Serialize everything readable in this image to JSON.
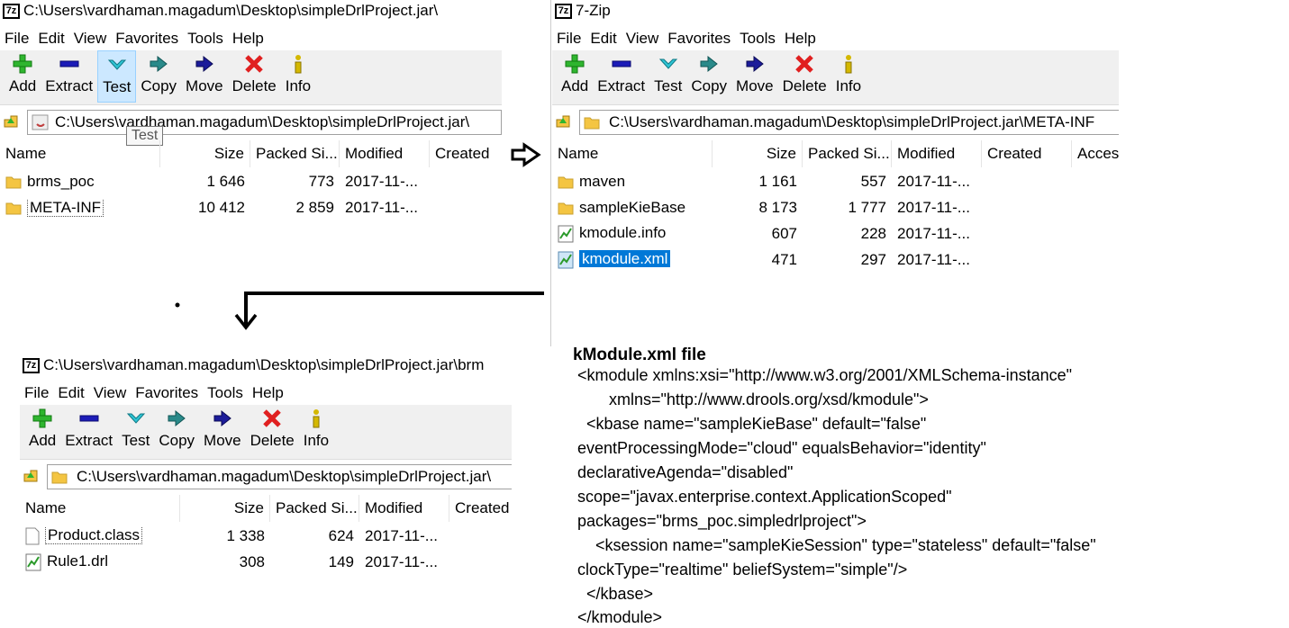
{
  "windows": {
    "top_left": {
      "title": "C:\\Users\\vardhaman.magadum\\Desktop\\simpleDrlProject.jar\\",
      "path": "C:\\Users\\vardhaman.magadum\\Desktop\\simpleDrlProject.jar\\",
      "tooltip": "Test",
      "columns": [
        "Name",
        "Size",
        "Packed Si...",
        "Modified",
        "Created"
      ],
      "rows": [
        {
          "name": "brms_poc",
          "size": "1 646",
          "packed": "773",
          "modified": "2017-11-..."
        },
        {
          "name": "META-INF",
          "size": "10 412",
          "packed": "2 859",
          "modified": "2017-11-..."
        }
      ]
    },
    "top_right": {
      "title": "7-Zip",
      "path": "C:\\Users\\vardhaman.magadum\\Desktop\\simpleDrlProject.jar\\META-INF",
      "columns": [
        "Name",
        "Size",
        "Packed Si...",
        "Modified",
        "Created",
        "Acces"
      ],
      "rows": [
        {
          "name": "maven",
          "size": "1 161",
          "packed": "557",
          "modified": "2017-11-..."
        },
        {
          "name": "sampleKieBase",
          "size": "8 173",
          "packed": "1 777",
          "modified": "2017-11-..."
        },
        {
          "name": "kmodule.info",
          "size": "607",
          "packed": "228",
          "modified": "2017-11-..."
        },
        {
          "name": "kmodule.xml",
          "size": "471",
          "packed": "297",
          "modified": "2017-11-..."
        }
      ]
    },
    "bottom_left": {
      "title": "C:\\Users\\vardhaman.magadum\\Desktop\\simpleDrlProject.jar\\brm",
      "path": "C:\\Users\\vardhaman.magadum\\Desktop\\simpleDrlProject.jar\\",
      "columns": [
        "Name",
        "Size",
        "Packed Si...",
        "Modified",
        "Created"
      ],
      "rows": [
        {
          "name": "Product.class",
          "size": "1 338",
          "packed": "624",
          "modified": "2017-11-..."
        },
        {
          "name": "Rule1.drl",
          "size": "308",
          "packed": "149",
          "modified": "2017-11-..."
        }
      ]
    }
  },
  "menu": [
    "File",
    "Edit",
    "View",
    "Favorites",
    "Tools",
    "Help"
  ],
  "toolbar": [
    "Add",
    "Extract",
    "Test",
    "Copy",
    "Move",
    "Delete",
    "Info"
  ],
  "icons": {
    "app": "7z",
    "add": "plus-icon",
    "extract": "minus-icon",
    "test": "chevron-down-icon",
    "copy": "double-arrow-icon",
    "move": "arrow-right-icon",
    "delete": "x-icon",
    "info": "info-icon"
  },
  "colors": {
    "add": "#2fb52f",
    "extract": "#1c1cb8",
    "test": "#2ec4d4",
    "copy": "#2a8a8a",
    "move": "#1c1c9a",
    "delete": "#e02020",
    "info": "#d4b800",
    "selection": "#0078d7",
    "folder": "#f4c542"
  },
  "xml": {
    "title": "kModule.xml file",
    "lines": [
      "<kmodule xmlns:xsi=\"http://www.w3.org/2001/XMLSchema-instance\"",
      "       xmlns=\"http://www.drools.org/xsd/kmodule\">",
      "  <kbase name=\"sampleKieBase\" default=\"false\"",
      "eventProcessingMode=\"cloud\" equalsBehavior=\"identity\"",
      "declarativeAgenda=\"disabled\"",
      "scope=\"javax.enterprise.context.ApplicationScoped\"",
      "packages=\"brms_poc.simpledrlproject\">",
      "    <ksession name=\"sampleKieSession\" type=\"stateless\" default=\"false\"",
      "clockType=\"realtime\" beliefSystem=\"simple\"/>",
      "  </kbase>",
      "</kmodule>"
    ]
  }
}
